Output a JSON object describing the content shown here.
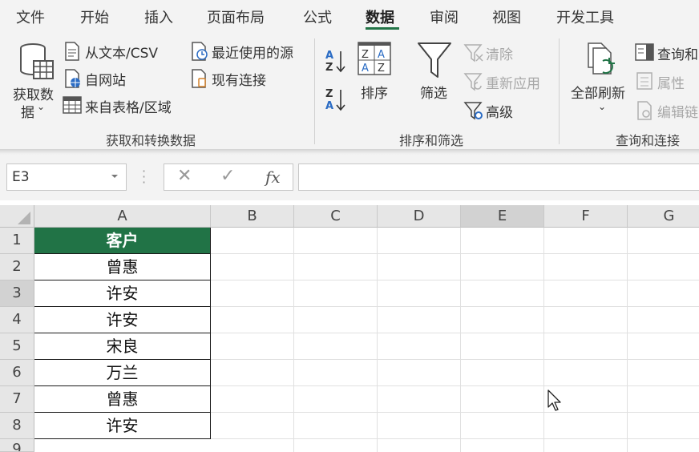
{
  "menu": {
    "tabs": [
      "文件",
      "开始",
      "插入",
      "页面布局",
      "公式",
      "数据",
      "审阅",
      "视图",
      "开发工具"
    ],
    "active_tab": "数据"
  },
  "ribbon": {
    "get_transform": {
      "get_data_line1": "获取数",
      "get_data_line2": "据",
      "from_text_csv": "从文本/CSV",
      "from_web": "自网站",
      "from_table_range": "来自表格/区域",
      "recent_sources": "最近使用的源",
      "existing_connections": "现有连接",
      "title": "获取和转换数据"
    },
    "sort_filter": {
      "sort": "排序",
      "filter": "筛选",
      "clear": "清除",
      "reapply": "重新应用",
      "advanced": "高级",
      "title": "排序和筛选"
    },
    "queries_connections": {
      "refresh_all": "全部刷新",
      "queries_connections": "查询和",
      "properties": "属性",
      "edit_links": "编辑链",
      "title": "查询和连接"
    }
  },
  "formula_bar": {
    "name_box": "E3",
    "cancel": "✕",
    "enter": "✓",
    "fx": "fx",
    "formula": ""
  },
  "sheet": {
    "columns": [
      "A",
      "B",
      "C",
      "D",
      "E",
      "F",
      "G"
    ],
    "rows": [
      "1",
      "2",
      "3",
      "4",
      "5",
      "6",
      "7",
      "8",
      "9"
    ],
    "selected_cell": "E3",
    "colors": {
      "header_fill": "#217346",
      "header_text": "#ffffff",
      "accent": "#217346"
    },
    "cells_A": [
      "客户",
      "曾惠",
      "许安",
      "许安",
      "宋良",
      "万兰",
      "曾惠",
      "许安"
    ]
  }
}
